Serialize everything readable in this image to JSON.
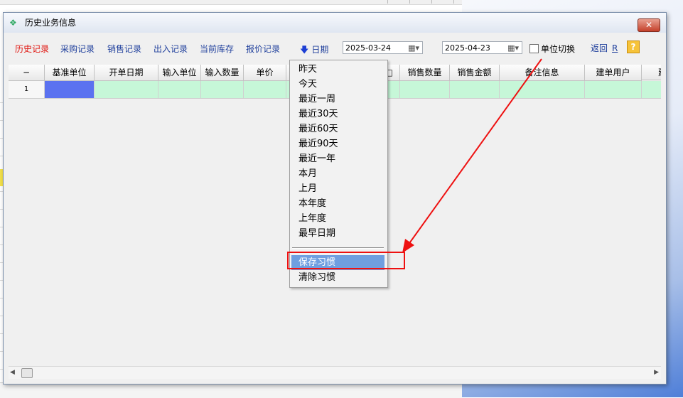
{
  "window": {
    "title": "历史业务信息",
    "close_label": "✕"
  },
  "toolbar": {
    "tabs": [
      {
        "label": "历史记录",
        "active": true
      },
      {
        "label": "采购记录",
        "active": false
      },
      {
        "label": "销售记录",
        "active": false
      },
      {
        "label": "出入记录",
        "active": false
      },
      {
        "label": "当前库存",
        "active": false
      },
      {
        "label": "报价记录",
        "active": false
      }
    ],
    "date_sort_label": "日期",
    "start_date": "2025-03-24",
    "end_date": "2025-04-23",
    "unit_switch_label": "单位切换",
    "unit_switch_checked": false,
    "back_label": "返回",
    "back_shortcut": "R",
    "help_label": "?"
  },
  "grid": {
    "columns": [
      "−",
      "基准单位",
      "开单日期",
      "输入单位",
      "输入数量",
      "单价",
      "",
      "销售数量",
      "销售金额",
      "备注信息",
      "建单用户",
      "建"
    ],
    "hidden_header_fragment": "□",
    "rows": [
      {
        "row_number": "1"
      }
    ]
  },
  "date_menu": {
    "items": [
      "昨天",
      "今天",
      "最近一周",
      "最近30天",
      "最近60天",
      "最近90天",
      "最近一年",
      "本月",
      "上月",
      "本年度",
      "上年度",
      "最早日期"
    ],
    "actions": [
      "保存习惯",
      "清除习惯"
    ],
    "highlighted": "保存习惯"
  },
  "colors": {
    "active_tab": "#e0140e",
    "link": "#1f3f9c",
    "row_fill": "#c6f7d8",
    "selected_cell": "#5b72f0",
    "menu_highlight": "#6f9fe0",
    "annotation": "#ee1111"
  }
}
